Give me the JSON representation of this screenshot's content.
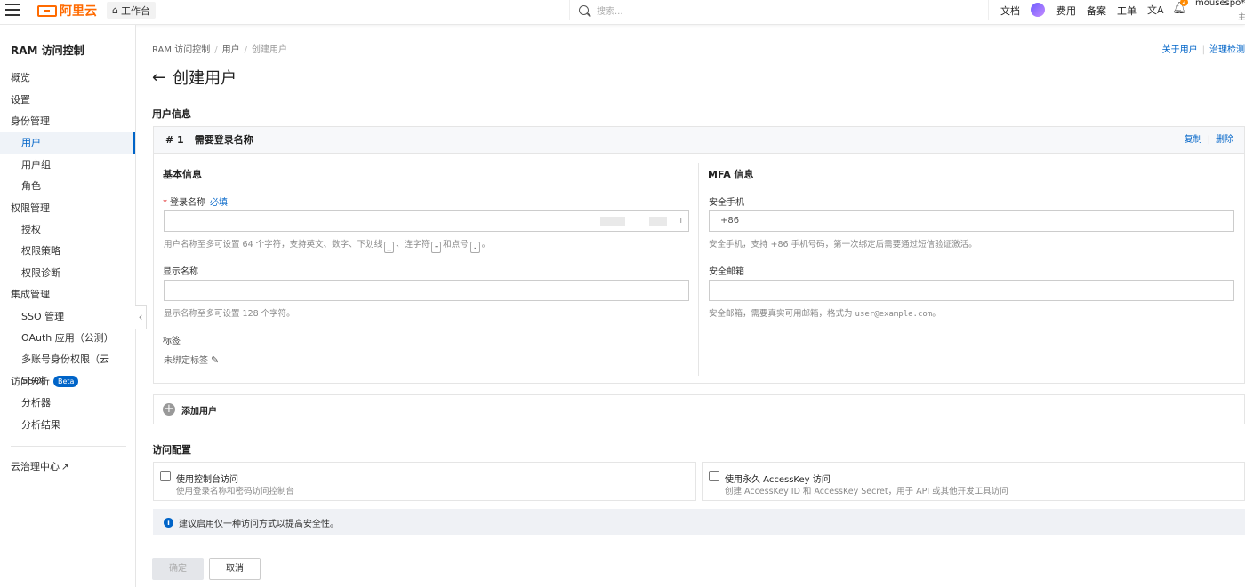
{
  "header": {
    "brand": "阿里云",
    "workbench": "工作台",
    "search_placeholder": "搜索...",
    "nav": [
      "文档",
      "费用",
      "备案",
      "工单"
    ],
    "bell_badge": "2",
    "username": "mousespo***",
    "user_sub": "主"
  },
  "sidebar": {
    "title": "RAM 访问控制",
    "items": [
      {
        "label": "概览"
      },
      {
        "label": "设置"
      },
      {
        "label": "身份管理"
      },
      {
        "label": "用户"
      },
      {
        "label": "用户组"
      },
      {
        "label": "角色"
      },
      {
        "label": "权限管理"
      },
      {
        "label": "授权"
      },
      {
        "label": "权限策略"
      },
      {
        "label": "权限诊断"
      },
      {
        "label": "集成管理"
      },
      {
        "label": "SSO 管理"
      },
      {
        "label": "OAuth 应用（公测）"
      },
      {
        "label": "多账号身份权限（云 SSO）"
      },
      {
        "label": "访问分析"
      },
      {
        "label": "分析器"
      },
      {
        "label": "分析结果"
      },
      {
        "label": "云治理中心"
      }
    ],
    "beta": "Beta"
  },
  "breadcrumb": [
    "RAM 访问控制",
    "用户",
    "创建用户"
  ],
  "top_links": [
    "关于用户",
    "治理检测"
  ],
  "page_title": "创建用户",
  "user_info": {
    "section": "用户信息",
    "card_num": "# 1",
    "card_title": "需要登录名称",
    "copy": "复制",
    "delete": "删除",
    "basic": {
      "title": "基本信息",
      "login_label": "登录名称",
      "required": "*",
      "must": "必填",
      "login_hint_1": "用户名称至多可设置 64 个字符，支持英文、数字、下划线",
      "key1": "_",
      "login_hint_2": "、连字符",
      "key2": "-",
      "login_hint_3": "和点号",
      "key3": ".",
      "login_hint_4": "。",
      "display_label": "显示名称",
      "display_hint": "显示名称至多可设置 128 个字符。",
      "tags_label": "标签",
      "tags_value": "未绑定标签"
    },
    "mfa": {
      "title": "MFA 信息",
      "phone_label": "安全手机",
      "phone_prefix": "+86",
      "phone_hint": "安全手机，支持 +86 手机号码，第一次绑定后需要通过短信验证激活。",
      "email_label": "安全邮箱",
      "email_hint_1": "安全邮箱，需要真实可用邮箱，格式为 ",
      "email_example": "user@example.com",
      "email_hint_2": "。"
    },
    "add_user": "添加用户"
  },
  "access": {
    "section": "访问配置",
    "console_title": "使用控制台访问",
    "console_desc": "使用登录名称和密码访问控制台",
    "ak_title": "使用永久 AccessKey 访问",
    "ak_desc": "创建 AccessKey ID 和 AccessKey Secret，用于 API 或其他开发工具访问",
    "notice": "建议启用仅一种访问方式以提高安全性。"
  },
  "buttons": {
    "ok": "确定",
    "cancel": "取消"
  }
}
